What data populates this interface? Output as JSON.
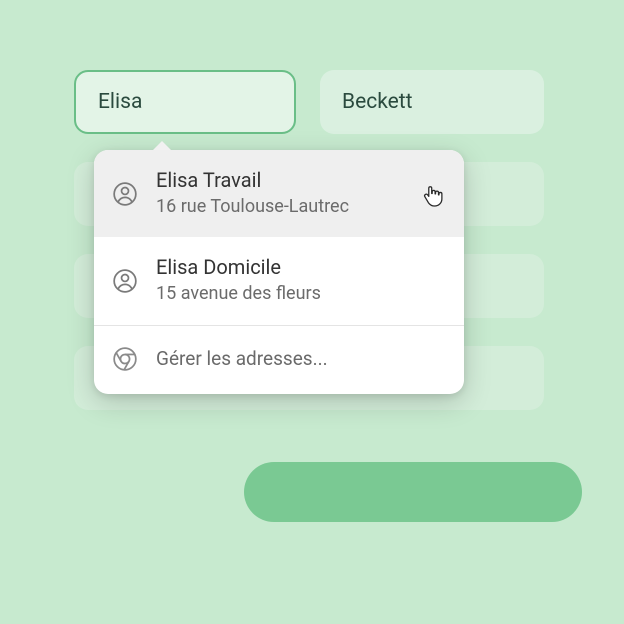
{
  "fields": {
    "firstName": "Elisa",
    "lastName": "Beckett"
  },
  "autofill": {
    "items": [
      {
        "name": "Elisa Travail",
        "sub": "16 rue Toulouse-Lautrec"
      },
      {
        "name": "Elisa Domicile",
        "sub": "15 avenue des fleurs"
      }
    ],
    "manageLabel": "Gérer les adresses..."
  },
  "colors": {
    "pageBg": "#c7eacf",
    "fieldBg": "#daf0e0",
    "fieldActiveBg": "#e3f4e7",
    "fieldActiveBorder": "#6abe87",
    "submitBg": "#7ac993"
  }
}
